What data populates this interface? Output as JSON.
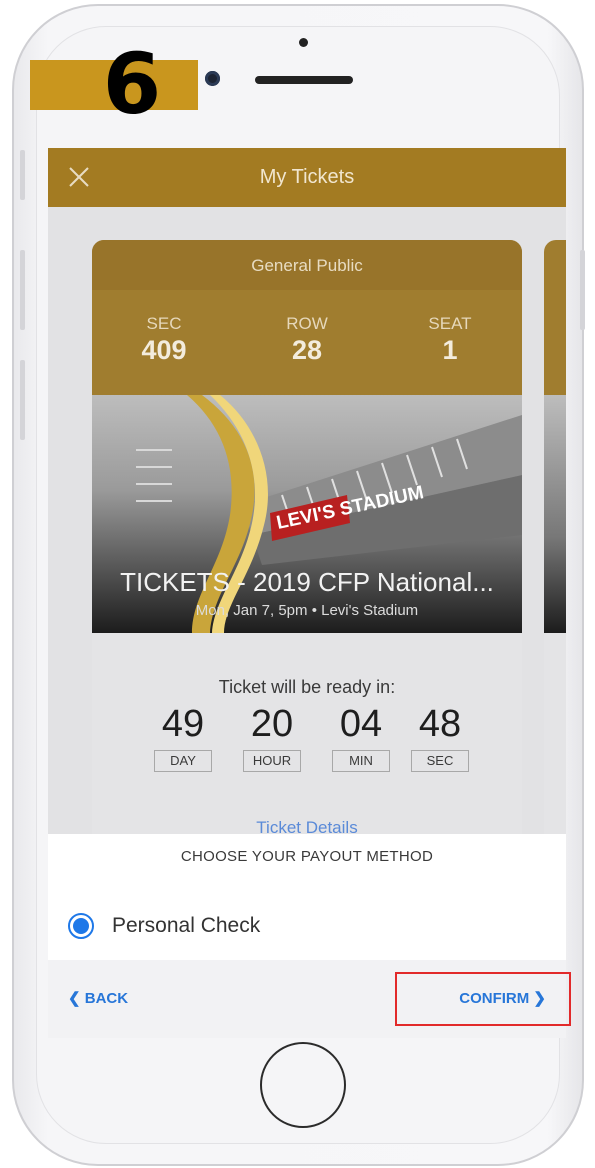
{
  "step_badge": {
    "number": "6",
    "color": "#c9961e"
  },
  "header": {
    "title": "My Tickets",
    "close_icon": "close-icon"
  },
  "ticket": {
    "type": "General Public",
    "seat_info": [
      {
        "label": "SEC",
        "value": "409"
      },
      {
        "label": "ROW",
        "value": "28"
      },
      {
        "label": "SEAT",
        "value": "1"
      }
    ],
    "event_title": "TICKETS - 2019 CFP National...",
    "event_subtitle": "Mon, Jan 7, 5pm • Levi's Stadium",
    "image_text": "LEVI'S STADIUM",
    "countdown": {
      "caption": "Ticket will be ready in:",
      "units": [
        {
          "value": "49",
          "label": "DAY"
        },
        {
          "value": "20",
          "label": "HOUR"
        },
        {
          "value": "04",
          "label": "MIN"
        },
        {
          "value": "48",
          "label": "SEC"
        }
      ]
    },
    "details_link": "Ticket Details"
  },
  "payout": {
    "title": "CHOOSE YOUR PAYOUT METHOD",
    "options": [
      {
        "label": "Personal Check",
        "selected": true
      }
    ]
  },
  "actions": {
    "back_label": "BACK",
    "confirm_label": "CONFIRM"
  },
  "colors": {
    "accent": "#a37b22",
    "link": "#2776d8",
    "highlight": "#e22a2a"
  }
}
